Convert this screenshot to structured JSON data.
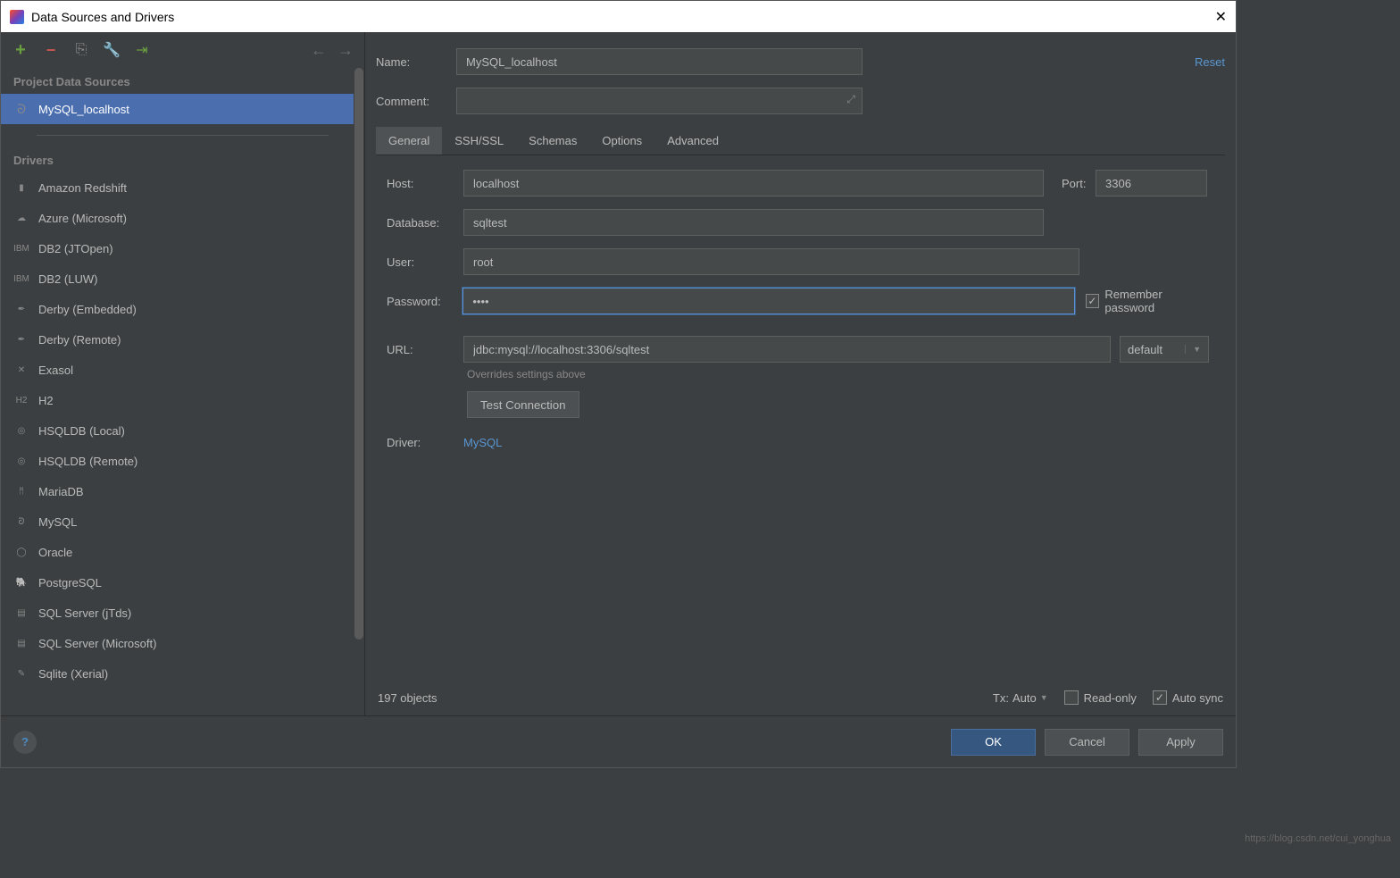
{
  "title": "Data Sources and Drivers",
  "toolbar": {
    "add": "+",
    "remove": "−"
  },
  "sections": {
    "sources_header": "Project Data Sources",
    "drivers_header": "Drivers"
  },
  "sources": [
    {
      "label": "MySQL_localhost",
      "selected": true
    }
  ],
  "drivers": [
    {
      "label": "Amazon Redshift",
      "icon": "redshift"
    },
    {
      "label": "Azure (Microsoft)",
      "icon": "azure"
    },
    {
      "label": "DB2 (JTOpen)",
      "icon": "db2"
    },
    {
      "label": "DB2 (LUW)",
      "icon": "db2"
    },
    {
      "label": "Derby (Embedded)",
      "icon": "derby"
    },
    {
      "label": "Derby (Remote)",
      "icon": "derby"
    },
    {
      "label": "Exasol",
      "icon": "exasol"
    },
    {
      "label": "H2",
      "icon": "h2"
    },
    {
      "label": "HSQLDB (Local)",
      "icon": "hsqldb"
    },
    {
      "label": "HSQLDB (Remote)",
      "icon": "hsqldb"
    },
    {
      "label": "MariaDB",
      "icon": "mariadb"
    },
    {
      "label": "MySQL",
      "icon": "mysql"
    },
    {
      "label": "Oracle",
      "icon": "oracle"
    },
    {
      "label": "PostgreSQL",
      "icon": "postgres"
    },
    {
      "label": "SQL Server (jTds)",
      "icon": "sqlserver"
    },
    {
      "label": "SQL Server (Microsoft)",
      "icon": "sqlserver"
    },
    {
      "label": "Sqlite (Xerial)",
      "icon": "sqlite"
    }
  ],
  "form": {
    "name_label": "Name:",
    "name_value": "MySQL_localhost",
    "comment_label": "Comment:",
    "comment_value": "",
    "reset": "Reset"
  },
  "tabs": [
    "General",
    "SSH/SSL",
    "Schemas",
    "Options",
    "Advanced"
  ],
  "general": {
    "host_label": "Host:",
    "host_value": "localhost",
    "port_label": "Port:",
    "port_value": "3306",
    "database_label": "Database:",
    "database_value": "sqltest",
    "user_label": "User:",
    "user_value": "root",
    "password_label": "Password:",
    "password_value": "••••",
    "remember_label": "Remember password",
    "url_label": "URL:",
    "url_value": "jdbc:mysql://localhost:3306/sqltest",
    "url_mode": "default",
    "url_hint": "Overrides settings above",
    "test_label": "Test Connection",
    "driver_label": "Driver:",
    "driver_value": "MySQL"
  },
  "status": {
    "objects": "197 objects",
    "tx_label": "Tx:",
    "tx_value": "Auto",
    "readonly": "Read-only",
    "autosync": "Auto sync"
  },
  "footer": {
    "ok": "OK",
    "cancel": "Cancel",
    "apply": "Apply"
  },
  "watermark": "https://blog.csdn.net/cui_yonghua"
}
